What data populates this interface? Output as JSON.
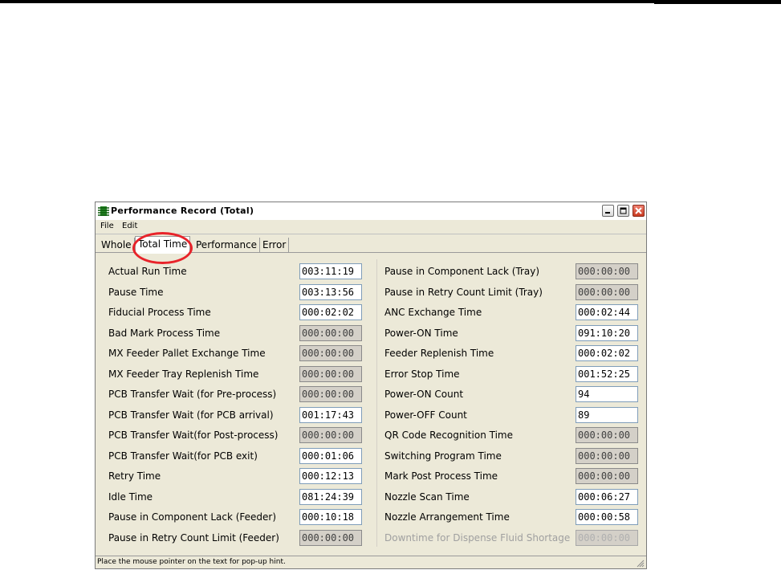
{
  "window": {
    "title": "Performance Record (Total)",
    "status_hint": "Place the mouse pointer on the text for pop-up hint."
  },
  "menu": [
    "File",
    "Edit"
  ],
  "tabs": [
    "Whole",
    "Total Time",
    "Performance",
    "Error"
  ],
  "active_tab": "Total Time",
  "highlight_color": "#e8232a",
  "left_rows": [
    {
      "label": "Actual Run Time",
      "value": "003:11:19",
      "state": "editable"
    },
    {
      "label": "Pause Time",
      "value": "003:13:56",
      "state": "editable"
    },
    {
      "label": "Fiducial Process Time",
      "value": "000:02:02",
      "state": "editable"
    },
    {
      "label": "Bad Mark Process Time",
      "value": "000:00:00",
      "state": "readonly"
    },
    {
      "label": "MX Feeder Pallet Exchange Time",
      "value": "000:00:00",
      "state": "readonly"
    },
    {
      "label": "MX Feeder Tray Replenish Time",
      "value": "000:00:00",
      "state": "readonly"
    },
    {
      "label": "PCB Transfer Wait (for Pre-process)",
      "value": "000:00:00",
      "state": "readonly"
    },
    {
      "label": "PCB Transfer Wait (for PCB arrival)",
      "value": "001:17:43",
      "state": "editable"
    },
    {
      "label": "PCB Transfer Wait(for Post-process)",
      "value": "000:00:00",
      "state": "readonly"
    },
    {
      "label": "PCB Transfer Wait(for PCB exit)",
      "value": "000:01:06",
      "state": "editable"
    },
    {
      "label": "Retry Time",
      "value": "000:12:13",
      "state": "editable"
    },
    {
      "label": "Idle Time",
      "value": "081:24:39",
      "state": "editable"
    },
    {
      "label": "Pause in Component Lack (Feeder)",
      "value": "000:10:18",
      "state": "editable"
    },
    {
      "label": "Pause in Retry Count Limit (Feeder)",
      "value": "000:00:00",
      "state": "readonly"
    }
  ],
  "right_rows": [
    {
      "label": "Pause in Component Lack (Tray)",
      "value": "000:00:00",
      "state": "readonly"
    },
    {
      "label": "Pause in Retry Count Limit (Tray)",
      "value": "000:00:00",
      "state": "readonly"
    },
    {
      "label": "ANC Exchange Time",
      "value": "000:02:44",
      "state": "editable"
    },
    {
      "label": "Power-ON Time",
      "value": "091:10:20",
      "state": "editable"
    },
    {
      "label": "Feeder Replenish Time",
      "value": "000:02:02",
      "state": "editable"
    },
    {
      "label": "Error Stop Time",
      "value": "001:52:25",
      "state": "editable"
    },
    {
      "label": "Power-ON Count",
      "value": "94",
      "state": "editable"
    },
    {
      "label": "Power-OFF Count",
      "value": "89",
      "state": "editable"
    },
    {
      "label": "QR Code Recognition Time",
      "value": "000:00:00",
      "state": "readonly"
    },
    {
      "label": "Switching Program Time",
      "value": "000:00:00",
      "state": "readonly"
    },
    {
      "label": "Mark Post Process Time",
      "value": "000:00:00",
      "state": "readonly"
    },
    {
      "label": "Nozzle Scan Time",
      "value": "000:06:27",
      "state": "editable"
    },
    {
      "label": "Nozzle Arrangement Time",
      "value": "000:00:58",
      "state": "editable"
    },
    {
      "label": "Downtime for Dispense Fluid Shortage",
      "value": "000:00:00",
      "state": "disabled"
    }
  ]
}
